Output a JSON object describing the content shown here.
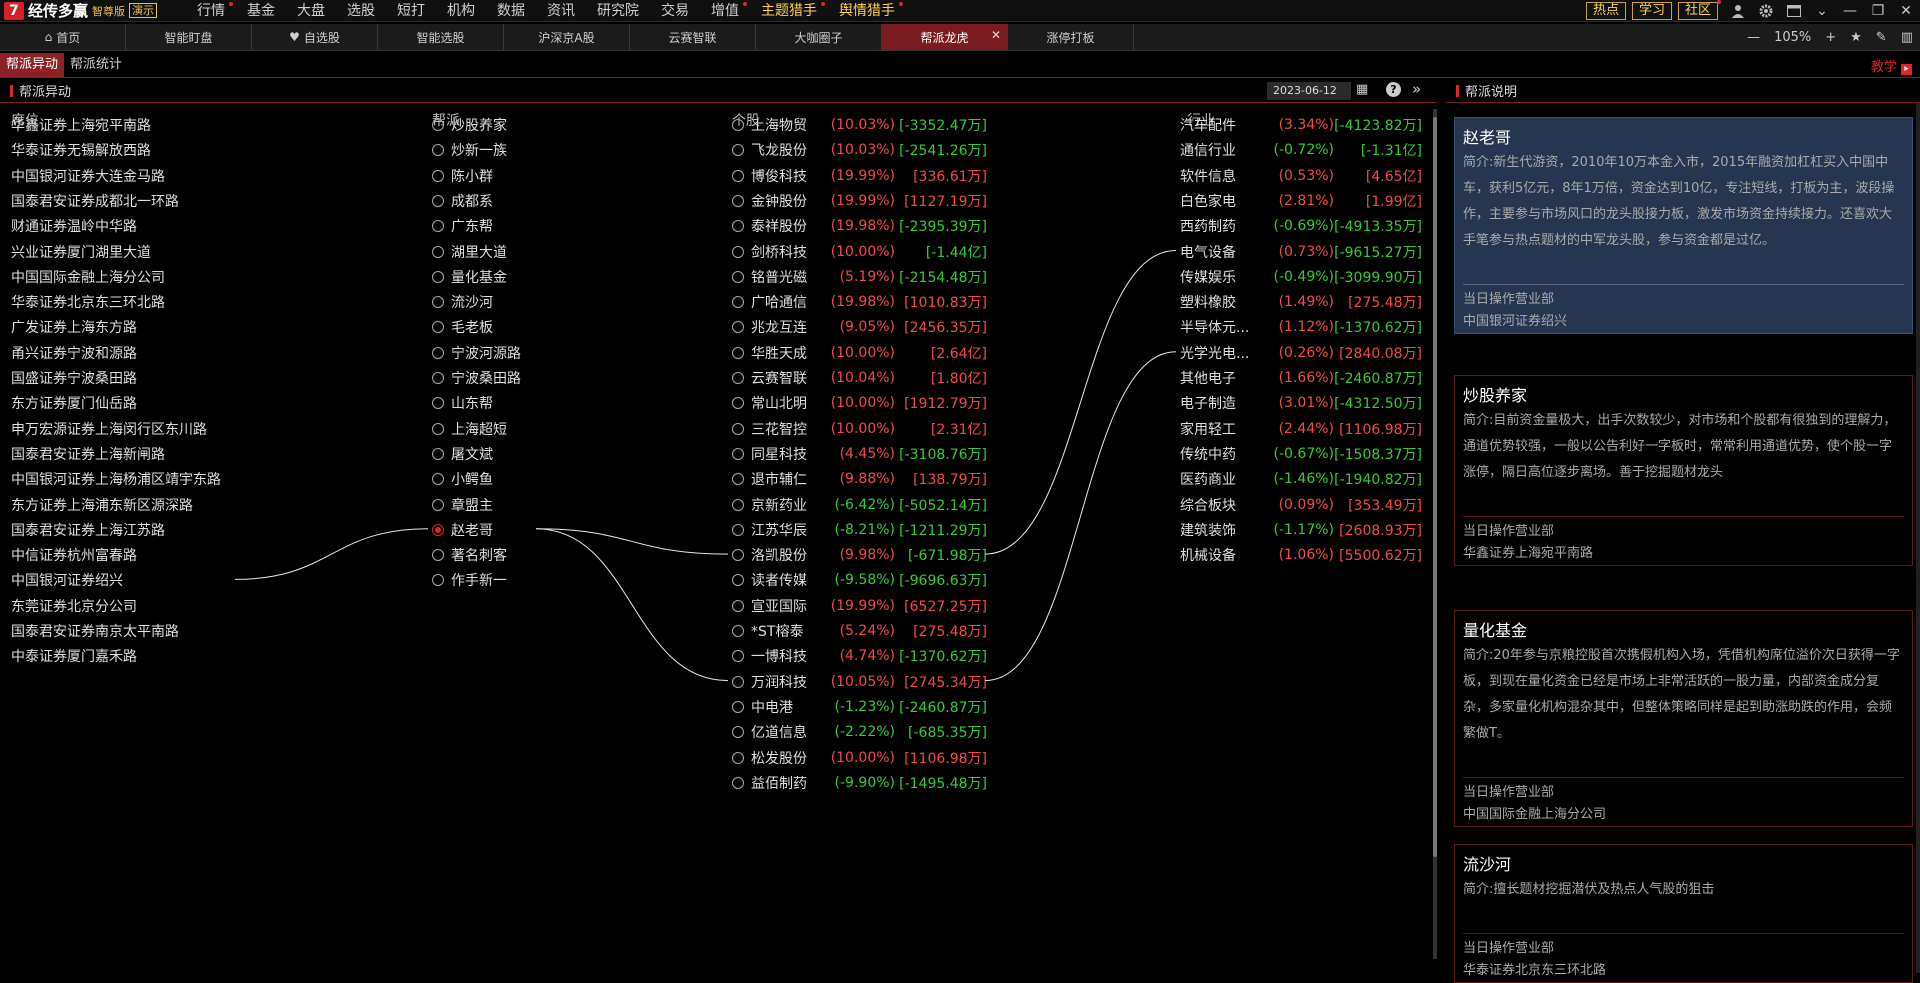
{
  "app": {
    "logo_glyph": "7",
    "name": "经传多赢",
    "edition": "智尊版",
    "demo": "演示"
  },
  "menu": [
    {
      "label": "行情",
      "dot": true
    },
    {
      "label": "基金"
    },
    {
      "label": "大盘"
    },
    {
      "label": "选股"
    },
    {
      "label": "短打"
    },
    {
      "label": "机构"
    },
    {
      "label": "数据"
    },
    {
      "label": "资讯"
    },
    {
      "label": "研究院"
    },
    {
      "label": "交易"
    },
    {
      "label": "增值",
      "dot": true
    },
    {
      "label": "主题猎手",
      "dot": true,
      "hl": true
    },
    {
      "label": "舆情猎手",
      "dot": true,
      "hl": true
    }
  ],
  "top_buttons": [
    {
      "label": "热点"
    },
    {
      "label": "学习"
    },
    {
      "label": "社区",
      "dot": true
    }
  ],
  "top_icons": [
    "user-icon",
    "gear-icon",
    "window-icon",
    "chevron-down-icon",
    "minimize-icon",
    "restore-icon",
    "close-icon"
  ],
  "tabs": [
    {
      "label": "首页",
      "icon": "home-icon"
    },
    {
      "label": "智能盯盘"
    },
    {
      "label": "自选股",
      "icon": "heart-icon"
    },
    {
      "label": "智能选股"
    },
    {
      "label": "沪深京A股"
    },
    {
      "label": "云赛智联"
    },
    {
      "label": "大咖圈子"
    },
    {
      "label": "帮派龙虎",
      "active": true,
      "closable": true
    },
    {
      "label": "涨停打板"
    }
  ],
  "tab_controls": {
    "zoom": "105%"
  },
  "subtabs": [
    {
      "label": "帮派异动",
      "active": true
    },
    {
      "label": "帮派统计"
    }
  ],
  "teach_label": "教学",
  "left_panel": {
    "title": "帮派异动",
    "date": "2023-06-12",
    "help": "?",
    "more": "»"
  },
  "columns": {
    "seat": "席位",
    "group": "帮派",
    "stock": "个股",
    "industry": "行业"
  },
  "seats": [
    "华鑫证券上海宛平南路",
    "华泰证券无锡解放西路",
    "中国银河证券大连金马路",
    "国泰君安证券成都北一环路",
    "财通证券温岭中华路",
    "兴业证券厦门湖里大道",
    "中国国际金融上海分公司",
    "华泰证券北京东三环北路",
    "广发证券上海东方路",
    "甬兴证券宁波和源路",
    "国盛证券宁波桑田路",
    "东方证券厦门仙岳路",
    "申万宏源证券上海闵行区东川路",
    "国泰君安证券上海新闸路",
    "中国银河证券上海杨浦区靖宇东路",
    "东方证券上海浦东新区源深路",
    "国泰君安证券上海江苏路",
    "中信证券杭州富春路",
    "中国银河证券绍兴",
    "东莞证券北京分公司",
    "国泰君安证券南京太平南路",
    "中泰证券厦门嘉禾路"
  ],
  "groups": [
    {
      "name": "炒股养家"
    },
    {
      "name": "炒新一族"
    },
    {
      "name": "陈小群"
    },
    {
      "name": "成都系"
    },
    {
      "name": "广东帮"
    },
    {
      "name": "湖里大道"
    },
    {
      "name": "量化基金"
    },
    {
      "name": "流沙河"
    },
    {
      "name": "毛老板"
    },
    {
      "name": "宁波河源路"
    },
    {
      "name": "宁波桑田路"
    },
    {
      "name": "山东帮"
    },
    {
      "name": "上海超短"
    },
    {
      "name": "屠文斌"
    },
    {
      "name": "小鳄鱼"
    },
    {
      "name": "章盟主"
    },
    {
      "name": "赵老哥",
      "selected": true
    },
    {
      "name": "著名刺客"
    },
    {
      "name": "作手新一"
    }
  ],
  "stocks": [
    {
      "name": "上海物贸",
      "pct": "(10.03%)",
      "amt": "[-3352.47万]",
      "pc": "red",
      "ac": "green"
    },
    {
      "name": "飞龙股份",
      "pct": "(10.03%)",
      "amt": "[-2541.26万]",
      "pc": "red",
      "ac": "green"
    },
    {
      "name": "博俊科技",
      "pct": "(19.99%)",
      "amt": "[336.61万]",
      "pc": "red",
      "ac": "red"
    },
    {
      "name": "金钟股份",
      "pct": "(19.99%)",
      "amt": "[1127.19万]",
      "pc": "red",
      "ac": "red"
    },
    {
      "name": "泰祥股份",
      "pct": "(19.98%)",
      "amt": "[-2395.39万]",
      "pc": "red",
      "ac": "green"
    },
    {
      "name": "剑桥科技",
      "pct": "(10.00%)",
      "amt": "[-1.44亿]",
      "pc": "red",
      "ac": "green"
    },
    {
      "name": "铭普光磁",
      "pct": "(5.19%)",
      "amt": "[-2154.48万]",
      "pc": "red",
      "ac": "green"
    },
    {
      "name": "广哈通信",
      "pct": "(19.98%)",
      "amt": "[1010.83万]",
      "pc": "red",
      "ac": "red"
    },
    {
      "name": "兆龙互连",
      "pct": "(9.05%)",
      "amt": "[2456.35万]",
      "pc": "red",
      "ac": "red"
    },
    {
      "name": "华胜天成",
      "pct": "(10.00%)",
      "amt": "[2.64亿]",
      "pc": "red",
      "ac": "red"
    },
    {
      "name": "云赛智联",
      "pct": "(10.04%)",
      "amt": "[1.80亿]",
      "pc": "red",
      "ac": "red"
    },
    {
      "name": "常山北明",
      "pct": "(10.00%)",
      "amt": "[1912.79万]",
      "pc": "red",
      "ac": "red"
    },
    {
      "name": "三花智控",
      "pct": "(10.00%)",
      "amt": "[2.31亿]",
      "pc": "red",
      "ac": "red"
    },
    {
      "name": "同星科技",
      "pct": "(4.45%)",
      "amt": "[-3108.76万]",
      "pc": "red",
      "ac": "green"
    },
    {
      "name": "退市辅仁",
      "pct": "(9.88%)",
      "amt": "[138.79万]",
      "pc": "red",
      "ac": "red"
    },
    {
      "name": "京新药业",
      "pct": "(-6.42%)",
      "amt": "[-5052.14万]",
      "pc": "green",
      "ac": "green"
    },
    {
      "name": "江苏华辰",
      "pct": "(-8.21%)",
      "amt": "[-1211.29万]",
      "pc": "green",
      "ac": "green"
    },
    {
      "name": "洛凯股份",
      "pct": "(9.98%)",
      "amt": "[-671.98万]",
      "pc": "red",
      "ac": "green"
    },
    {
      "name": "读者传媒",
      "pct": "(-9.58%)",
      "amt": "[-9696.63万]",
      "pc": "green",
      "ac": "green"
    },
    {
      "name": "宣亚国际",
      "pct": "(19.99%)",
      "amt": "[6527.25万]",
      "pc": "red",
      "ac": "red"
    },
    {
      "name": "*ST榕泰",
      "pct": "(5.24%)",
      "amt": "[275.48万]",
      "pc": "red",
      "ac": "red"
    },
    {
      "name": "一博科技",
      "pct": "(4.74%)",
      "amt": "[-1370.62万]",
      "pc": "red",
      "ac": "green"
    },
    {
      "name": "万润科技",
      "pct": "(10.05%)",
      "amt": "[2745.34万]",
      "pc": "red",
      "ac": "red"
    },
    {
      "name": "中电港",
      "pct": "(-1.23%)",
      "amt": "[-2460.87万]",
      "pc": "green",
      "ac": "green"
    },
    {
      "name": "亿道信息",
      "pct": "(-2.22%)",
      "amt": "[-685.35万]",
      "pc": "green",
      "ac": "green"
    },
    {
      "name": "松发股份",
      "pct": "(10.00%)",
      "amt": "[1106.98万]",
      "pc": "red",
      "ac": "red"
    },
    {
      "name": "益佰制药",
      "pct": "(-9.90%)",
      "amt": "[-1495.48万]",
      "pc": "green",
      "ac": "green"
    }
  ],
  "industries": [
    {
      "name": "汽车配件",
      "pct": "(3.34%)",
      "amt": "[-4123.82万]",
      "pc": "red",
      "ac": "green"
    },
    {
      "name": "通信行业",
      "pct": "(-0.72%)",
      "amt": "[-1.31亿]",
      "pc": "green",
      "ac": "green"
    },
    {
      "name": "软件信息",
      "pct": "(0.53%)",
      "amt": "[4.65亿]",
      "pc": "red",
      "ac": "red"
    },
    {
      "name": "白色家电",
      "pct": "(2.81%)",
      "amt": "[1.99亿]",
      "pc": "red",
      "ac": "red"
    },
    {
      "name": "西药制药",
      "pct": "(-0.69%)",
      "amt": "[-4913.35万]",
      "pc": "green",
      "ac": "green"
    },
    {
      "name": "电气设备",
      "pct": "(0.73%)",
      "amt": "[-9615.27万]",
      "pc": "red",
      "ac": "green"
    },
    {
      "name": "传媒娱乐",
      "pct": "(-0.49%)",
      "amt": "[-3099.90万]",
      "pc": "green",
      "ac": "green"
    },
    {
      "name": "塑料橡胶",
      "pct": "(1.49%)",
      "amt": "[275.48万]",
      "pc": "red",
      "ac": "red"
    },
    {
      "name": "半导体元...",
      "pct": "(1.12%)",
      "amt": "[-1370.62万]",
      "pc": "red",
      "ac": "green"
    },
    {
      "name": "光学光电...",
      "pct": "(0.26%)",
      "amt": "[2840.08万]",
      "pc": "red",
      "ac": "red"
    },
    {
      "name": "其他电子",
      "pct": "(1.66%)",
      "amt": "[-2460.87万]",
      "pc": "red",
      "ac": "green"
    },
    {
      "name": "电子制造",
      "pct": "(3.01%)",
      "amt": "[-4312.50万]",
      "pc": "red",
      "ac": "green"
    },
    {
      "name": "家用轻工",
      "pct": "(2.44%)",
      "amt": "[1106.98万]",
      "pc": "red",
      "ac": "red"
    },
    {
      "name": "传统中药",
      "pct": "(-0.67%)",
      "amt": "[-1508.37万]",
      "pc": "green",
      "ac": "green"
    },
    {
      "name": "医药商业",
      "pct": "(-1.46%)",
      "amt": "[-1940.82万]",
      "pc": "green",
      "ac": "green"
    },
    {
      "name": "综合板块",
      "pct": "(0.09%)",
      "amt": "[353.49万]",
      "pc": "red",
      "ac": "red"
    },
    {
      "name": "建筑装饰",
      "pct": "(-1.17%)",
      "amt": "[2608.93万]",
      "pc": "green",
      "ac": "red"
    },
    {
      "name": "机械设备",
      "pct": "(1.06%)",
      "amt": "[5500.62万]",
      "pc": "red",
      "ac": "red"
    }
  ],
  "links": {
    "seat": "中国银河证券绍兴",
    "group": "赵老哥",
    "stocks": [
      "洛凯股份",
      "万润科技"
    ],
    "industries": [
      "电气设备",
      "光学光电..."
    ]
  },
  "right_panel": {
    "title": "帮派说明"
  },
  "cards": [
    {
      "name": "赵老哥",
      "desc": "简介:新生代游资，2010年10万本金入市，2015年融资加杠杠买入中国中车，获利5亿元，8年1万倍，资金达到10亿，专注短线，打板为主，波段操作，主要参与市场风口的龙头股接力板，激发市场资金持续接力。还喜欢大手笔参与热点题材的中军龙头股，参与资金都是过亿。",
      "label": "当日操作营业部",
      "value": "中国银河证券绍兴",
      "selected": true
    },
    {
      "name": "炒股养家",
      "desc": "简介:目前资金量极大，出手次数较少，对市场和个股都有很独到的理解力，通道优势较强，一般以公告利好一字板时，常常利用通道优势，使个股一字涨停，隔日高位逐步离场。善于挖掘题材龙头",
      "label": "当日操作营业部",
      "value": "华鑫证券上海宛平南路"
    },
    {
      "name": "量化基金",
      "desc": "简介:20年参与京粮控股首次携假机构入场，凭借机构席位溢价次日获得一字板，到现在量化资金已经是市场上非常活跃的一股力量，内部资金成分复杂，多家量化机构混杂其中，但整体策略同样是起到助涨助跌的作用，会频繁做T。",
      "label": "当日操作营业部",
      "value": "中国国际金融上海分公司"
    },
    {
      "name": "流沙河",
      "desc": "简介:擅长题材挖掘潜伏及热点人气股的狙击",
      "label": "当日操作营业部",
      "value": "华泰证券北京东三环北路"
    }
  ],
  "colors": {
    "accent": "#8d2226",
    "up": "#f24a4a",
    "down": "#33cc33",
    "highlight": "#ffd34d",
    "selected_card": "#263650"
  }
}
